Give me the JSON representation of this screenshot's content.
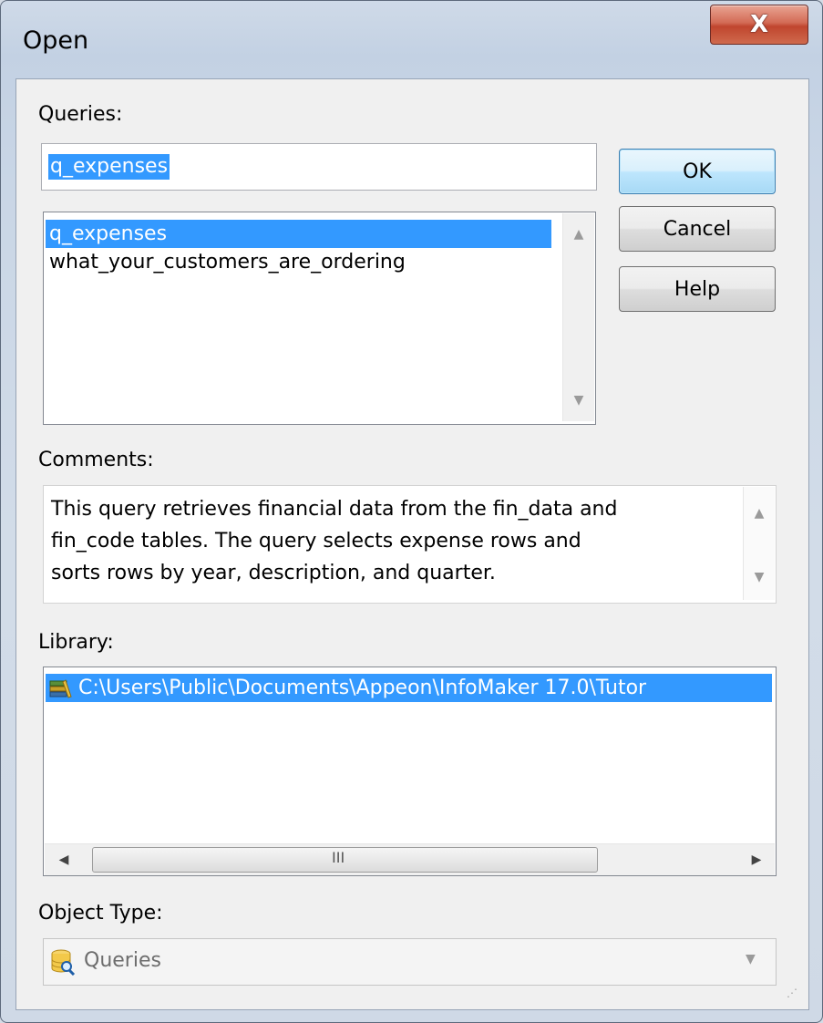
{
  "window": {
    "title": "Open",
    "close_glyph": "X"
  },
  "queries": {
    "label": "Queries:",
    "input_value": "q_expenses",
    "items": [
      "q_expenses",
      "what_your_customers_are_ordering"
    ],
    "selected_index": 0
  },
  "buttons": {
    "ok": "OK",
    "cancel": "Cancel",
    "help": "Help"
  },
  "comments": {
    "label": "Comments:",
    "lines": [
      "This query retrieves financial data from the fin_data and",
      "fin_code tables. The query selects expense rows and",
      "sorts rows by year, description, and quarter."
    ]
  },
  "library": {
    "label": "Library:",
    "path": "C:\\Users\\Public\\Documents\\Appeon\\InfoMaker 17.0\\Tutor",
    "icon": "library-books-icon",
    "hscroll_thumb_glyph": "III"
  },
  "object_type": {
    "label": "Object Type:",
    "value": "Queries",
    "icon": "query-database-icon"
  },
  "colors": {
    "selection": "#3399ff",
    "close_button": "#c0452e",
    "default_button": "#3c7fb1"
  }
}
